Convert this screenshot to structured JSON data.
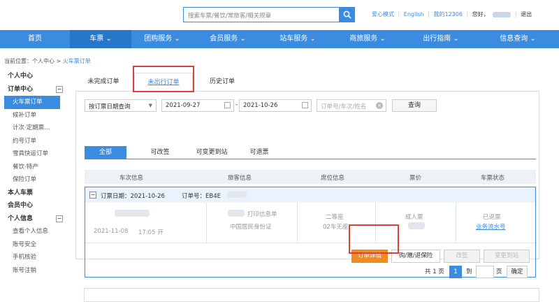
{
  "header": {
    "search_placeholder": "搜索车票/餐饮/常旅客/相关规章",
    "links": [
      "爱心模式",
      "English",
      "我的12306"
    ],
    "greeting": "您好，",
    "logout": "退出"
  },
  "nav": {
    "items": [
      "首页",
      "车票 ⌄",
      "团购服务 ⌄",
      "会员服务 ⌄",
      "站车服务 ⌄",
      "商旅服务 ⌄",
      "出行指南 ⌄",
      "信息查询 ⌄"
    ]
  },
  "breadcrumb": {
    "prefix": "当前位置：个人中心 > ",
    "current": "火车票订单"
  },
  "sidebar": {
    "personal_center": "个人中心",
    "order_center": "订单中心",
    "orders": [
      "火车票订单",
      "候补订单",
      "计次·定期票...",
      "约号订单",
      "雪具快运订单",
      "餐饮·特产",
      "保险订单"
    ],
    "my_tickets": "本人车票",
    "member_center": "会员中心",
    "personal_info": "个人信息",
    "info_items": [
      "查看个人信息",
      "账号安全",
      "手机核验",
      "账号注销"
    ]
  },
  "tabs": [
    "未完成订单",
    "未出行订单",
    "历史订单"
  ],
  "query": {
    "type": "按订票日期查询",
    "date_from": "2021-09-27",
    "separator": "-",
    "date_to": "2021-10-26",
    "keyword_placeholder": "订单号/车次/姓名",
    "button": "查询"
  },
  "filters": [
    "全部",
    "可改签",
    "可变更到站",
    "可退票"
  ],
  "table_headers": [
    "车次信息",
    "旅客信息",
    "席位信息",
    "票价",
    "车票状态"
  ],
  "order": {
    "date_label": "订票日期：2021-10-26",
    "number_label": "订单号：EB4E",
    "travel_date": "2021-11-08",
    "depart_time": "17:05 开",
    "passenger_note": "打印信息单",
    "id_type": "中国居民身份证",
    "seat_class": "二等座",
    "seat_no": "02车无座",
    "ticket_type": "成人票",
    "status": "已退票",
    "status_link": "业务流水号"
  },
  "actions": [
    "订单详情",
    "购/赠/退保险",
    "改签",
    "变更到站"
  ],
  "pager": {
    "total": "共 1 页",
    "current": "1",
    "goto": "到",
    "page_unit": "页",
    "confirm": "确定"
  }
}
